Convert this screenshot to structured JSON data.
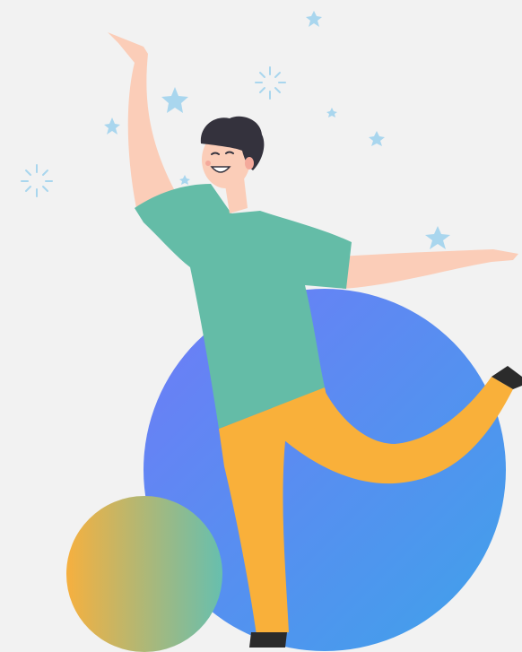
{
  "illustration": {
    "subject": "dancing-person",
    "colors": {
      "background": "#f2f2f2",
      "big_ball_start": "#6f7bf7",
      "big_ball_end": "#3fa2ea",
      "small_ball_start": "#f6b03f",
      "small_ball_end": "#67bfae",
      "shirt": "#64bca7",
      "pants": "#f9b03a",
      "skin": "#fbcdb8",
      "hair": "#34323d",
      "shoes": "#2b2b2b",
      "sparkle": "#a9d6ee"
    },
    "decor_icons": [
      "star-icon",
      "sparkle-burst-icon"
    ]
  }
}
